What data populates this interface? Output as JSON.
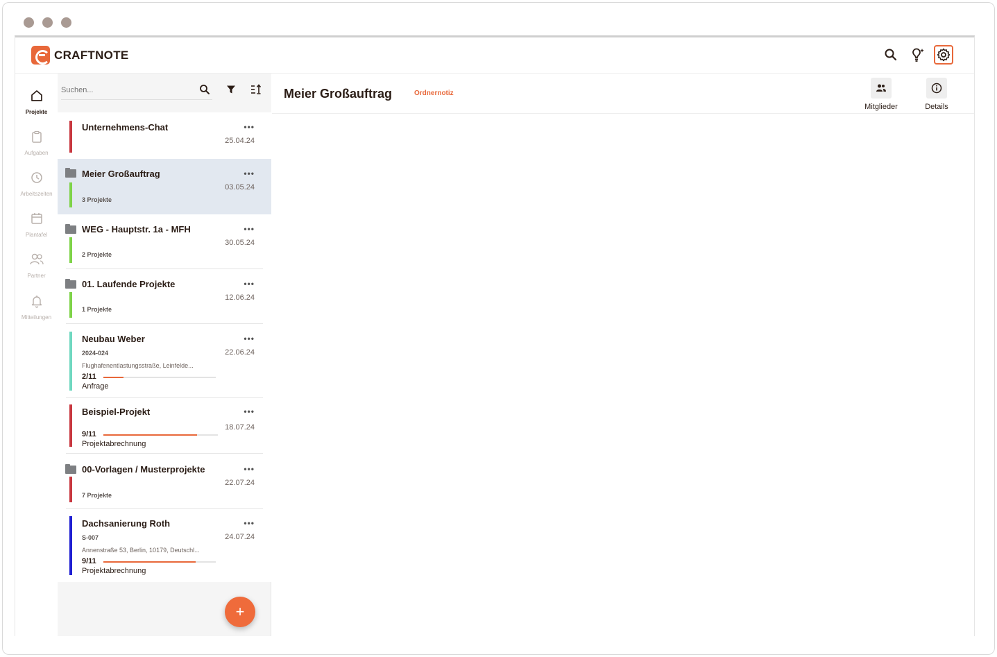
{
  "app": {
    "logo_text": "CRAFTNOTE"
  },
  "colors": {
    "accent": "#e8683a",
    "selected_bg": "#e2e8f0"
  },
  "topbar": {
    "icons": [
      "search-icon",
      "lightbulb-icon",
      "gear-icon"
    ]
  },
  "rail": {
    "items": [
      {
        "label": "Projekte",
        "icon": "home-icon",
        "active": true
      },
      {
        "label": "Aufgaben",
        "icon": "clipboard-icon"
      },
      {
        "label": "Arbeitszeiten",
        "icon": "clock-icon"
      },
      {
        "label": "Plantafel",
        "icon": "calendar-icon"
      },
      {
        "label": "Partner",
        "icon": "people-icon"
      },
      {
        "label": "Mitteilungen",
        "icon": "bell-icon"
      }
    ]
  },
  "search": {
    "placeholder": "Suchen..."
  },
  "projects": [
    {
      "name": "Unternehmens-Chat",
      "date": "25.04.24",
      "more": "•••",
      "color": "#c8373f"
    },
    {
      "name": "Meier Großauftrag",
      "date": "03.05.24",
      "more": "•••",
      "sub": "3 Projekte",
      "color": "#7ed348",
      "folder": true,
      "selected": true
    },
    {
      "name": "WEG - Hauptstr. 1a - MFH",
      "date": "30.05.24",
      "more": "•••",
      "sub": "2 Projekte",
      "color": "#7ed348",
      "folder": true
    },
    {
      "name": "01. Laufende Projekte",
      "date": "12.06.24",
      "more": "•••",
      "sub": "1 Projekte",
      "color": "#7ed348",
      "folder": true
    },
    {
      "name": "Neubau Weber",
      "date": "22.06.24",
      "more": "•••",
      "sub": "2024-024",
      "address": "Flughafenentlastungsstraße, Leinfelde...",
      "progress": "2/11",
      "progress_value": 0.18,
      "phase": "Anfrage",
      "color": "#6fd8c0"
    },
    {
      "name": "Beispiel-Projekt",
      "date": "18.07.24",
      "more": "•••",
      "progress": "9/11",
      "progress_value": 0.82,
      "phase": "Projektabrechnung",
      "color": "#c8373f"
    },
    {
      "name": "00-Vorlagen / Musterprojekte",
      "date": "22.07.24",
      "more": "•••",
      "sub": "7 Projekte",
      "color": "#c8373f",
      "folder": true
    },
    {
      "name": "Dachsanierung Roth",
      "date": "24.07.24",
      "more": "•••",
      "sub": "S-007",
      "address": "Annenstraße 53, Berlin, 10179, Deutschl...",
      "progress": "9/11",
      "progress_value": 0.82,
      "phase": "Projektabrechnung",
      "color": "#1e1ed2"
    }
  ],
  "fab": {
    "label": "+"
  },
  "main": {
    "title": "Meier Großauftrag",
    "tag": "Ordnernotiz",
    "actions": [
      {
        "label": "Mitglieder",
        "icon": "members-icon"
      },
      {
        "label": "Details",
        "icon": "info-icon"
      }
    ]
  }
}
